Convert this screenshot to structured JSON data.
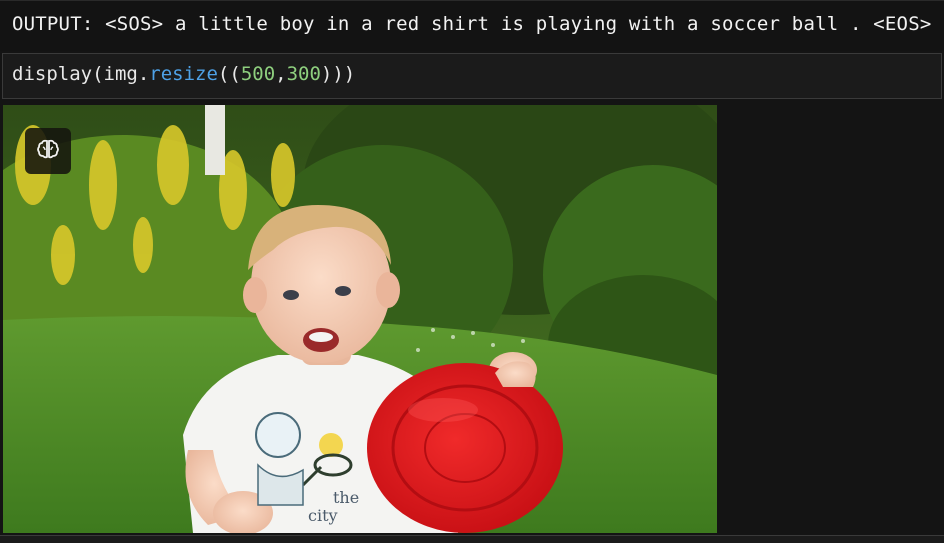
{
  "output": {
    "text": "OUTPUT: <SOS> a little boy in a red shirt is playing with a soccer ball . <EOS>"
  },
  "code_cell": {
    "prefix": "display(img.",
    "function": "resize",
    "open": "((",
    "arg1": "500",
    "comma": ",",
    "arg2": "300",
    "close": ")))"
  },
  "image": {
    "shirt_print_word1": "the",
    "shirt_print_word2": "city"
  },
  "colors": {
    "function": "#4ea1e6",
    "number": "#8ecf7e",
    "frisbee": "#e3161c"
  },
  "icons": {
    "overlay_button": "brain-icon"
  }
}
